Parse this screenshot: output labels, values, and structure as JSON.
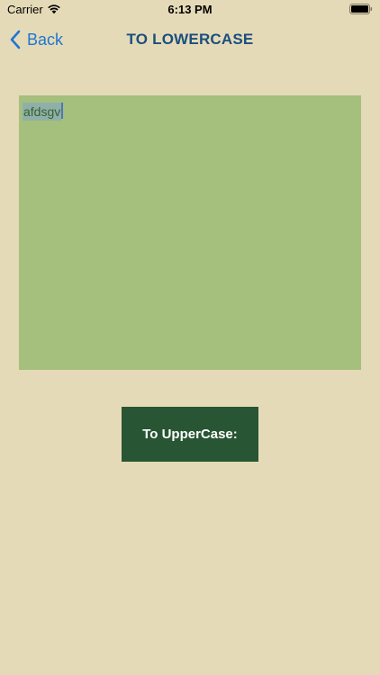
{
  "status_bar": {
    "carrier": "Carrier",
    "time": "6:13 PM",
    "icons": [
      "wifi-icon",
      "battery-icon"
    ]
  },
  "nav": {
    "back_label": "Back",
    "title": "TO LOWERCASE",
    "back_icon": "chevron-left-icon"
  },
  "editor": {
    "text": "afdsgv"
  },
  "actions": {
    "upper_label": "To UpperCase:"
  },
  "colors": {
    "background": "#e5dab7",
    "editor_background": "#a5bf7d",
    "button_background": "#285533",
    "accent": "#1f76d2",
    "title": "#1b4f7e"
  }
}
